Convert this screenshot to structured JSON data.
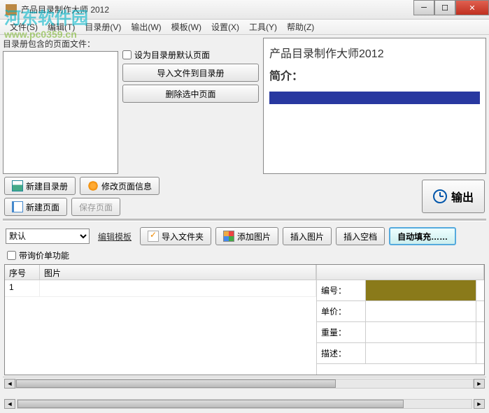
{
  "window": {
    "title": "产品目录制作大师 2012"
  },
  "menu": {
    "file": "文件(S)",
    "edit": "编辑(T)",
    "catalog": "目录册(V)",
    "output": "输出(W)",
    "template": "模板(W)",
    "settings": "设置(X)",
    "tools": "工具(Y)",
    "help": "帮助(Z)"
  },
  "watermark": {
    "text": "河东软件园",
    "url": "www.pc0359.cn"
  },
  "left": {
    "label": "目录册包含的页面文件："
  },
  "mid": {
    "default_check": "设为目录册默认页面",
    "import_btn": "导入文件到目录册",
    "delete_btn": "删除选中页面"
  },
  "preview": {
    "title": "产品目录制作大师2012",
    "subtitle": "简介："
  },
  "toolbar2": {
    "new_catalog": "新建目录册",
    "modify_page": "修改页面信息",
    "new_page": "新建页面",
    "save_page": "保存页面",
    "output": "输出"
  },
  "toolbar3": {
    "template_default": "默认",
    "edit_template": "编辑模板",
    "import_folder": "导入文件夹",
    "add_image": "添加图片",
    "insert_image": "插入图片",
    "insert_blank": "插入空档",
    "auto_fill": "自动填充……",
    "quote_check": "带询价单功能"
  },
  "table": {
    "col_seq": "序号",
    "col_img": "图片",
    "rows": [
      {
        "seq": "1",
        "img": ""
      }
    ]
  },
  "form": {
    "code": "编号：",
    "price": "单价：",
    "weight": "重量：",
    "desc": "描述："
  }
}
